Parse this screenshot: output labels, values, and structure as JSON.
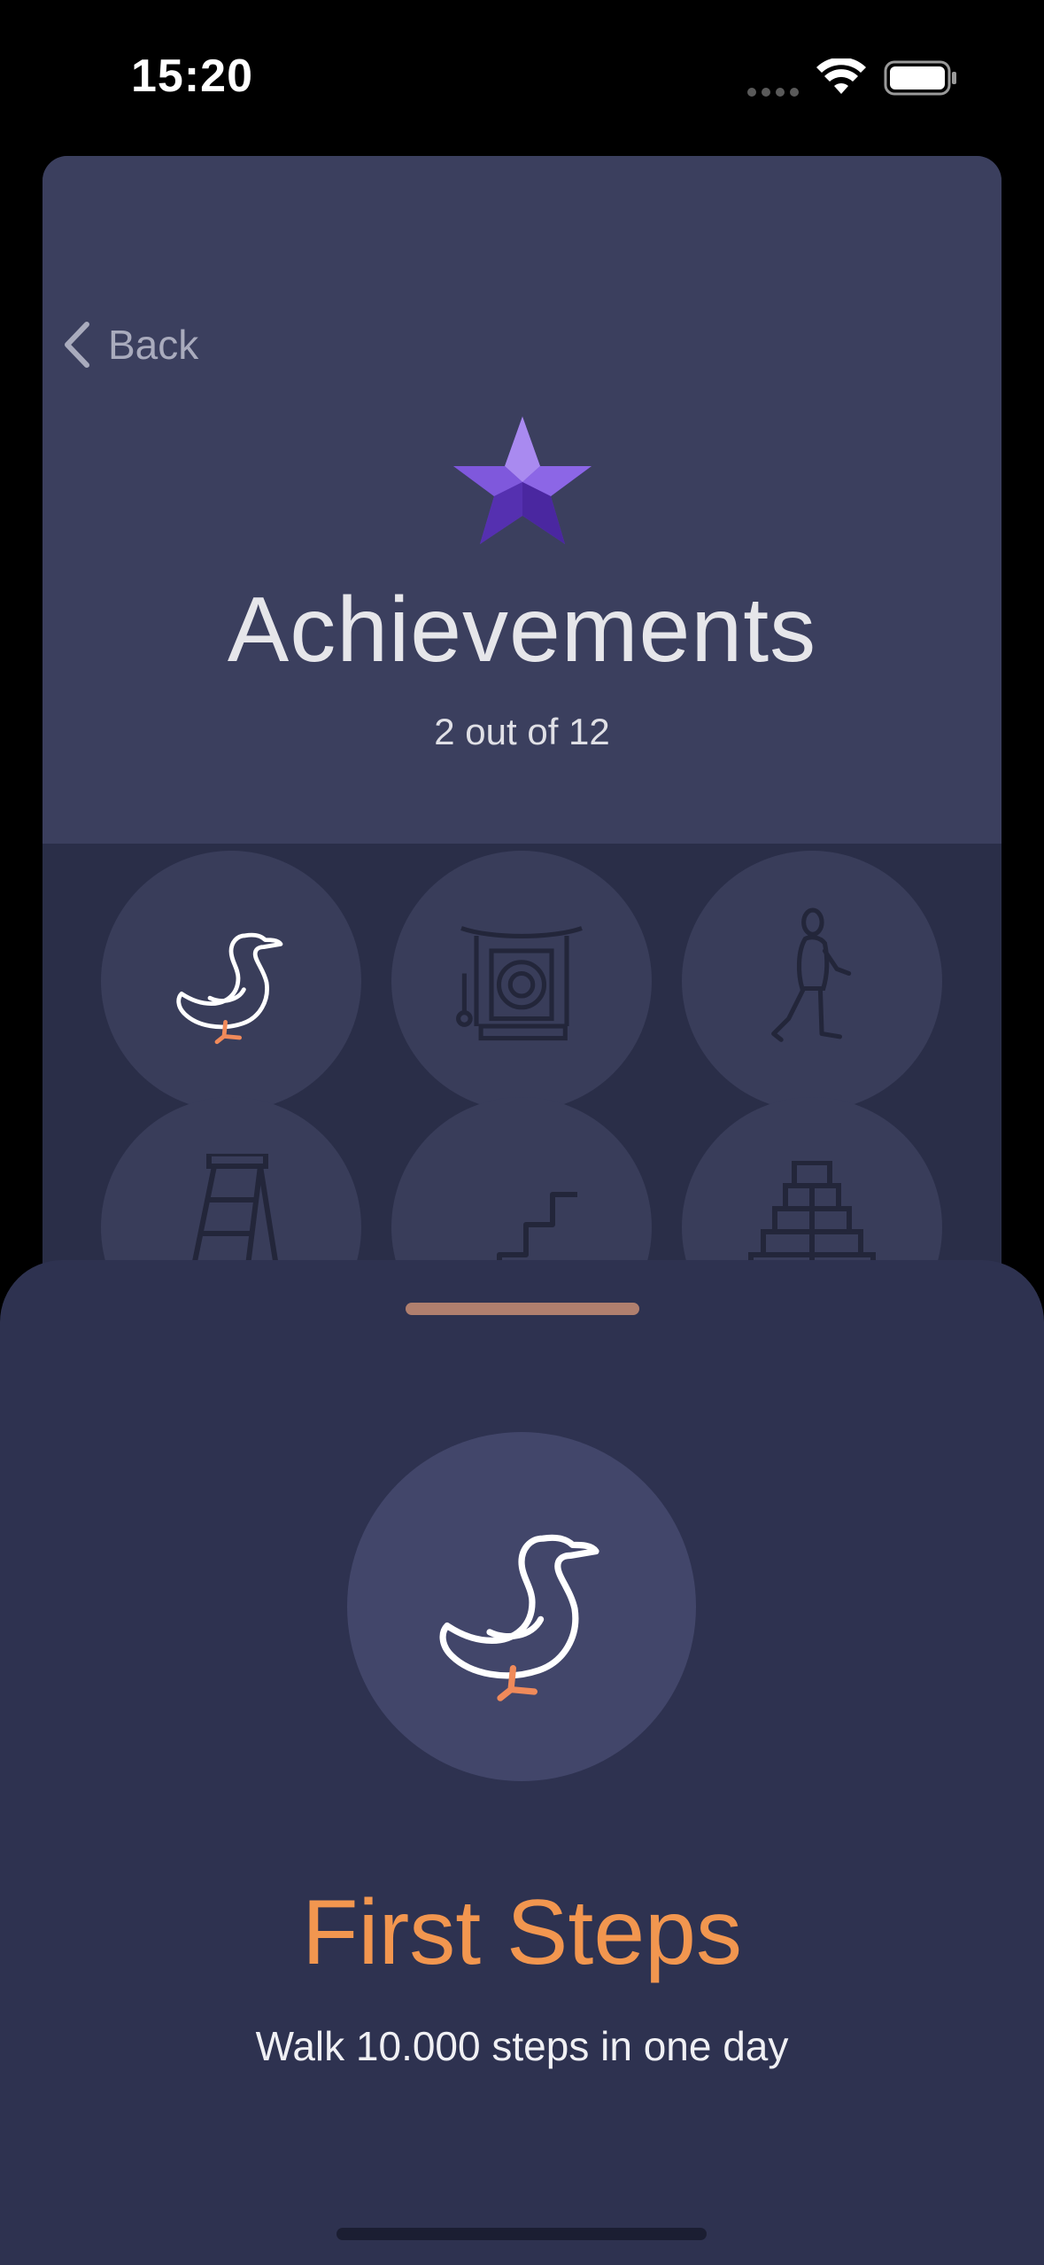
{
  "status_bar": {
    "time": "15:20"
  },
  "header": {
    "back_label": "Back",
    "title": "Achievements",
    "progress": "2 out of 12"
  },
  "badges": [
    {
      "icon": "duck-icon",
      "unlocked": true
    },
    {
      "icon": "gong-icon",
      "unlocked": false
    },
    {
      "icon": "walking-person-icon",
      "unlocked": false
    },
    {
      "icon": "ladder-icon",
      "unlocked": false
    },
    {
      "icon": "stairs-icon",
      "unlocked": false
    },
    {
      "icon": "pyramid-icon",
      "unlocked": false
    }
  ],
  "detail_sheet": {
    "icon": "duck-icon",
    "title": "First Steps",
    "description": "Walk 10.000 steps in one day"
  },
  "colors": {
    "background": "#000000",
    "header_bg": "#3b3f5e",
    "grid_bg": "#2a2e48",
    "sheet_bg": "#2e3250",
    "accent_orange": "#f2964f",
    "star_purple": "#7b4fd6"
  }
}
